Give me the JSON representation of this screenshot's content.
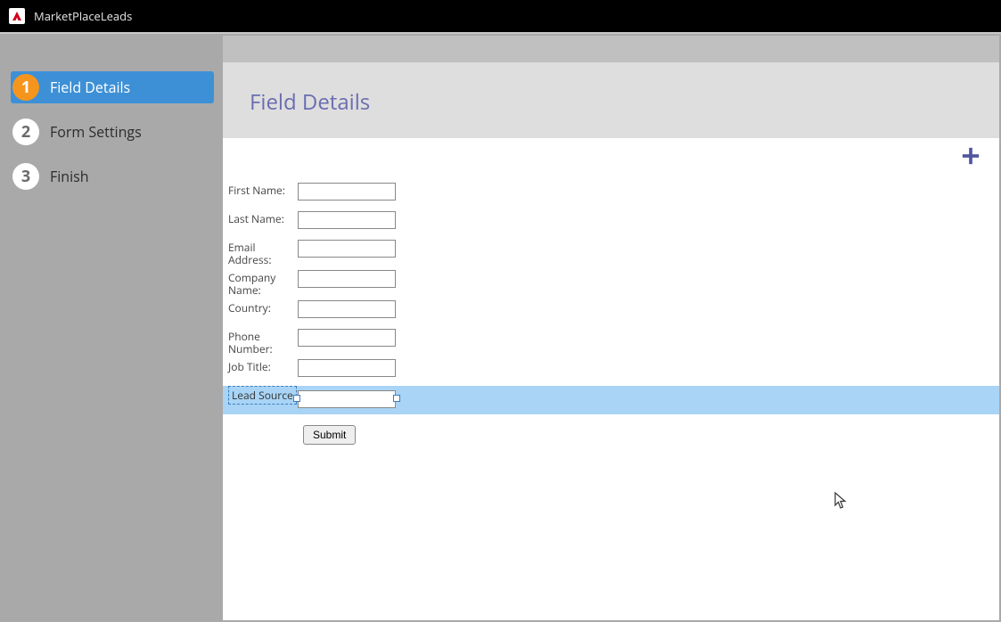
{
  "app": {
    "title": "MarketPlaceLeads"
  },
  "sidebar": {
    "steps": [
      {
        "num": "1",
        "label": "Field Details",
        "active": true
      },
      {
        "num": "2",
        "label": "Form Settings",
        "active": false
      },
      {
        "num": "3",
        "label": "Finish",
        "active": false
      }
    ]
  },
  "page": {
    "heading": "Field Details"
  },
  "form": {
    "fields": [
      {
        "label": "First Name:",
        "value": "",
        "selected": false
      },
      {
        "label": "Last Name:",
        "value": "",
        "selected": false
      },
      {
        "label": "Email Address:",
        "value": "",
        "selected": false
      },
      {
        "label": "Company Name:",
        "value": "",
        "selected": false
      },
      {
        "label": "Country:",
        "value": "",
        "selected": false
      },
      {
        "label": "Phone Number:",
        "value": "",
        "selected": false
      },
      {
        "label": "Job Title:",
        "value": "",
        "selected": false
      },
      {
        "label": "Lead Source",
        "value": "",
        "selected": true
      }
    ],
    "submit_label": "Submit"
  },
  "icons": {
    "add": "plus-icon"
  }
}
